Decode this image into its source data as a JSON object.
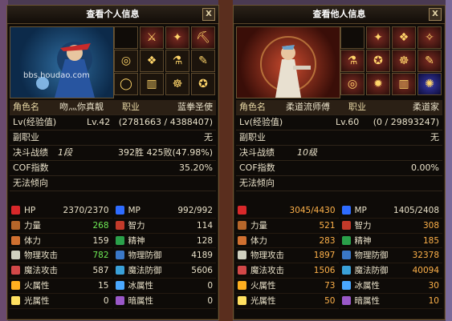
{
  "watermark": "bbs.houdao.com",
  "left": {
    "title": "查看个人信息",
    "close": "X",
    "name_label": "角色名",
    "name": "吻灬你真靓",
    "job_label": "职业",
    "job": "蓝拳圣使",
    "lv_label": "Lv(经验值)",
    "lv": "Lv.42",
    "exp": "(2781663 / 4388407)",
    "sub_label": "副职业",
    "sub": "无",
    "pvp_label": "决斗战绩",
    "pvp_rank": "1段",
    "pvp_record": "392胜 425败(47.98%)",
    "cof_label": "COF指数",
    "cof": "35.20%",
    "tend_label": "无法倾向",
    "stats": [
      {
        "icon": "heart-icon",
        "label": "HP",
        "value": "2370/2370",
        "cls": "white"
      },
      {
        "icon": "mp-heart-icon",
        "label": "MP",
        "value": "992/992",
        "cls": "white"
      },
      {
        "icon": "strength-icon",
        "label": "力量",
        "value": "268",
        "cls": "green"
      },
      {
        "icon": "intelligence-icon",
        "label": "智力",
        "value": "114",
        "cls": "white"
      },
      {
        "icon": "vitality-icon",
        "label": "体力",
        "value": "159",
        "cls": "white"
      },
      {
        "icon": "spirit-icon",
        "label": "精神",
        "value": "128",
        "cls": "white"
      },
      {
        "icon": "sword-icon",
        "label": "物理攻击",
        "value": "782",
        "cls": "green"
      },
      {
        "icon": "shield-icon",
        "label": "物理防御",
        "value": "4189",
        "cls": "white"
      },
      {
        "icon": "magic-attack-icon",
        "label": "魔法攻击",
        "value": "587",
        "cls": "white"
      },
      {
        "icon": "magic-defense-icon",
        "label": "魔法防御",
        "value": "5606",
        "cls": "white"
      },
      {
        "icon": "fire-icon",
        "label": "火属性",
        "value": "15",
        "cls": "white"
      },
      {
        "icon": "ice-icon",
        "label": "冰属性",
        "value": "0",
        "cls": "white"
      },
      {
        "icon": "light-icon",
        "label": "光属性",
        "value": "0",
        "cls": "white"
      },
      {
        "icon": "dark-icon",
        "label": "暗属性",
        "value": "0",
        "cls": "white"
      }
    ]
  },
  "right": {
    "title": "查看他人信息",
    "close": "X",
    "name_label": "角色名",
    "name": "柔道流师傅",
    "job_label": "职业",
    "job": "柔道家",
    "lv_label": "Lv(经验值)",
    "lv": "Lv.60",
    "exp": "(0 / 29893247)",
    "sub_label": "副职业",
    "sub": "无",
    "pvp_label": "决斗战绩",
    "pvp_rank": "10级",
    "pvp_record": "",
    "cof_label": "COF指数",
    "cof": "0.00%",
    "tend_label": "无法倾向",
    "stats": [
      {
        "icon": "heart-icon",
        "label": "",
        "value": "3045/4430",
        "cls": "orange"
      },
      {
        "icon": "mp-heart-icon",
        "label": "MP",
        "value": "1405/2408",
        "cls": "white"
      },
      {
        "icon": "strength-icon",
        "label": "力量",
        "value": "521",
        "cls": "orange"
      },
      {
        "icon": "intelligence-icon",
        "label": "智力",
        "value": "308",
        "cls": "orange"
      },
      {
        "icon": "vitality-icon",
        "label": "体力",
        "value": "283",
        "cls": "orange"
      },
      {
        "icon": "spirit-icon",
        "label": "精神",
        "value": "185",
        "cls": "orange"
      },
      {
        "icon": "sword-icon",
        "label": "物理攻击",
        "value": "1897",
        "cls": "orange"
      },
      {
        "icon": "shield-icon",
        "label": "物理防御",
        "value": "32378",
        "cls": "orange"
      },
      {
        "icon": "magic-attack-icon",
        "label": "魔法攻击",
        "value": "1506",
        "cls": "orange"
      },
      {
        "icon": "magic-defense-icon",
        "label": "魔法防御",
        "value": "40094",
        "cls": "orange"
      },
      {
        "icon": "fire-icon",
        "label": "火属性",
        "value": "73",
        "cls": "orange"
      },
      {
        "icon": "ice-icon",
        "label": "冰属性",
        "value": "30",
        "cls": "orange"
      },
      {
        "icon": "light-icon",
        "label": "光属性",
        "value": "50",
        "cls": "orange"
      },
      {
        "icon": "dark-icon",
        "label": "暗属性",
        "value": "10",
        "cls": "orange"
      }
    ]
  },
  "colors": {
    "heart": "#d8282a",
    "mp": "#2e6cff",
    "strength": "#b5662a",
    "intelligence": "#c23a2a",
    "vitality": "#d07030",
    "spirit": "#2aa04a",
    "sword": "#d0d0c0",
    "shield": "#3a78c8",
    "magic_attack": "#d24848",
    "magic_defense": "#3aa0d8",
    "fire": "#ffb020",
    "ice": "#4aa8ff",
    "light": "#ffe060",
    "dark": "#9a58c8"
  }
}
